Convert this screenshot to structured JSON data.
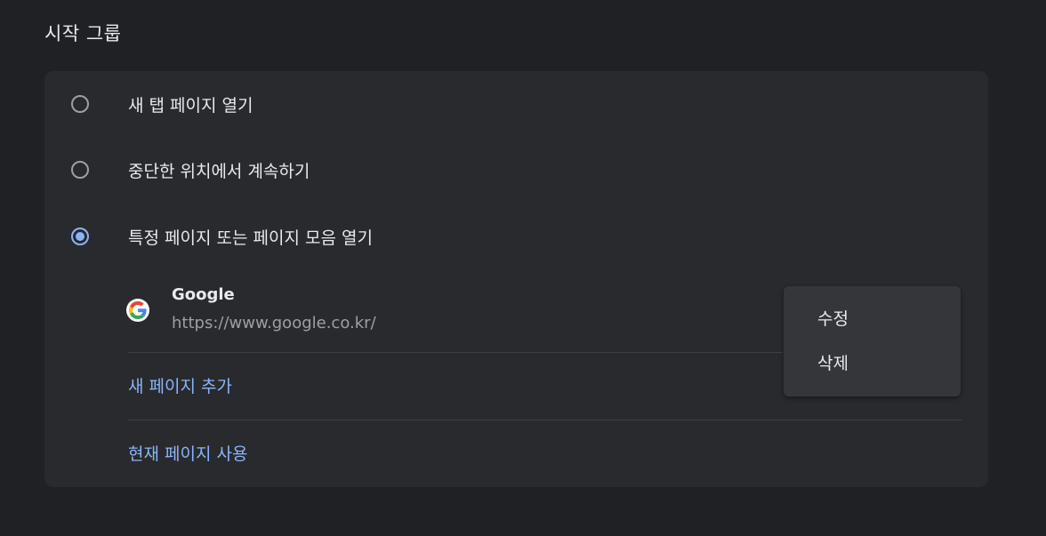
{
  "section": {
    "title": "시작 그룹"
  },
  "options": [
    {
      "label": "새 탭 페이지 열기",
      "checked": false
    },
    {
      "label": "중단한 위치에서 계속하기",
      "checked": false
    },
    {
      "label": "특정 페이지 또는 페이지 모음 열기",
      "checked": true
    }
  ],
  "pages": [
    {
      "name": "Google",
      "url": "https://www.google.co.kr/",
      "icon": "google-icon"
    }
  ],
  "actions": {
    "add_page": "새 페이지 추가",
    "use_current": "현재 페이지 사용"
  },
  "context_menu": {
    "items": [
      "수정",
      "삭제"
    ]
  },
  "colors": {
    "background": "#202124",
    "card": "#292a2d",
    "accent": "#8ab4f8",
    "menu": "#35363a"
  }
}
